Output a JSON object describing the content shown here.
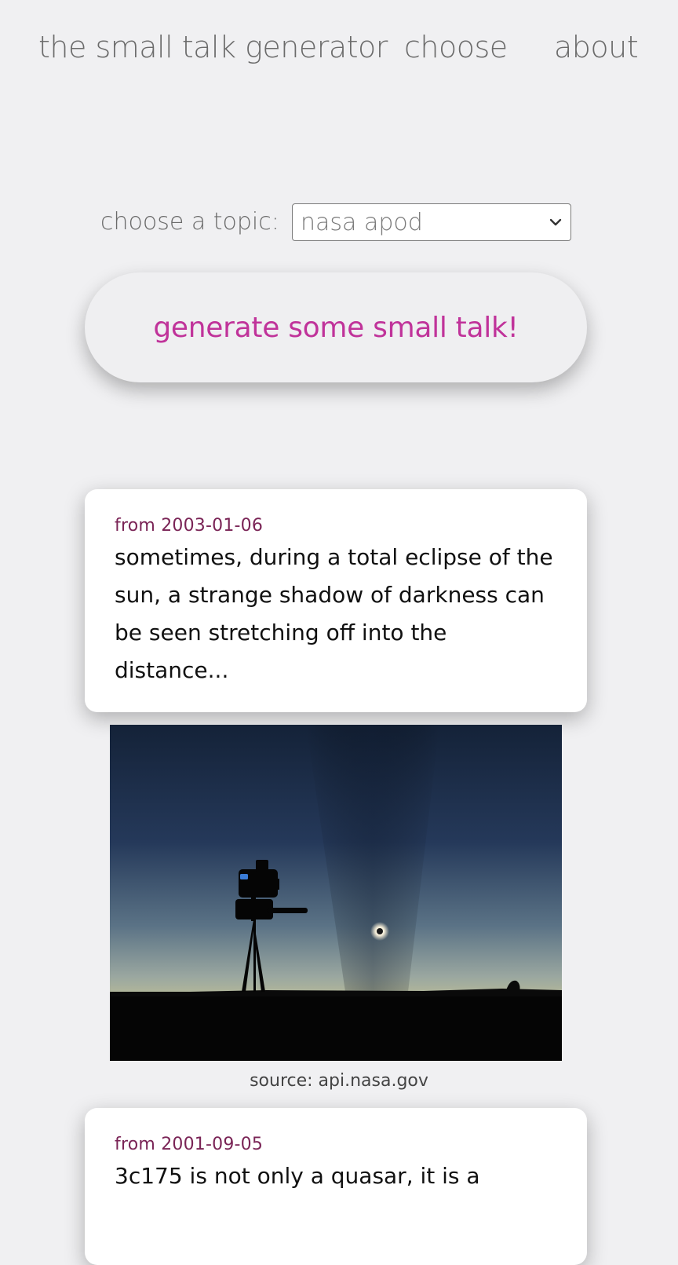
{
  "nav": {
    "home": "the small talk generator",
    "choose": "choose",
    "about": "about"
  },
  "topic": {
    "label": "choose a topic:",
    "selected": "nasa apod"
  },
  "generate": {
    "label": "generate some small talk!"
  },
  "facts": [
    {
      "date": "from 2003-01-06",
      "text": "sometimes, during a total eclipse of the sun, a strange shadow of darkness can be seen stretching off into the distance...",
      "source": "source: api.nasa.gov"
    },
    {
      "date": "from 2001-09-05",
      "text": "3c175 is not only a quasar, it is a"
    }
  ],
  "colors": {
    "accent": "#c0339a",
    "date": "#7a2456",
    "background": "#f0f0f2"
  }
}
